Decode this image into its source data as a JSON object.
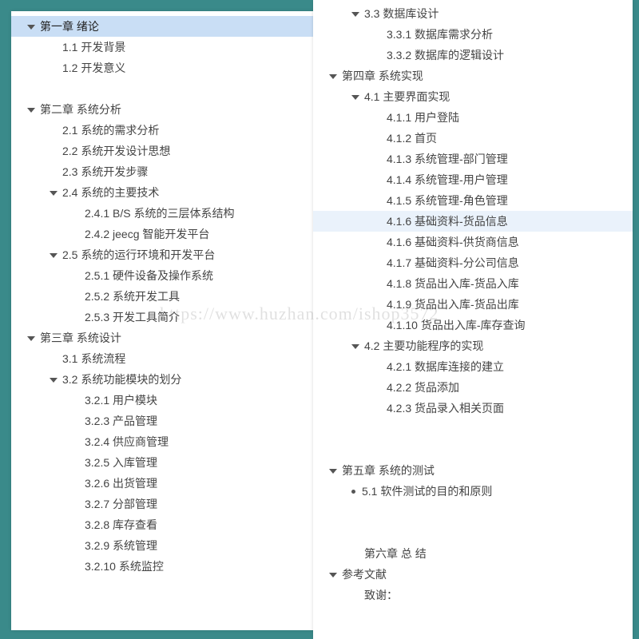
{
  "watermark": "https://www.huzhan.com/ishop3572",
  "left": [
    {
      "indent": 0,
      "marker": "arrow",
      "selected": "blue",
      "text": "第一章  绪论"
    },
    {
      "indent": 1,
      "marker": "none",
      "text": "1.1 开发背景"
    },
    {
      "indent": 1,
      "marker": "none",
      "text": "1.2 开发意义"
    },
    {
      "indent": 0,
      "marker": "none",
      "text": ""
    },
    {
      "indent": 0,
      "marker": "arrow",
      "text": "第二章  系统分析"
    },
    {
      "indent": 1,
      "marker": "none",
      "text": "2.1 系统的需求分析"
    },
    {
      "indent": 1,
      "marker": "none",
      "text": "2.2 系统开发设计思想"
    },
    {
      "indent": 1,
      "marker": "none",
      "text": "2.3 系统开发步骤"
    },
    {
      "indent": 1,
      "marker": "arrow",
      "text": "2.4 系统的主要技术"
    },
    {
      "indent": 2,
      "marker": "none",
      "text": "2.4.1 B/S 系统的三层体系结构"
    },
    {
      "indent": 2,
      "marker": "none",
      "text": "2.4.2 jeecg  智能开发平台"
    },
    {
      "indent": 1,
      "marker": "arrow",
      "text": "2.5 系统的运行环境和开发平台"
    },
    {
      "indent": 2,
      "marker": "none",
      "text": "2.5.1 硬件设备及操作系统"
    },
    {
      "indent": 2,
      "marker": "none",
      "text": "2.5.2 系统开发工具"
    },
    {
      "indent": 2,
      "marker": "none",
      "text": "2.5.3 开发工具简介"
    },
    {
      "indent": 0,
      "marker": "arrow",
      "text": "第三章  系统设计"
    },
    {
      "indent": 1,
      "marker": "none",
      "text": "3.1 系统流程"
    },
    {
      "indent": 1,
      "marker": "arrow",
      "text": "3.2 系统功能模块的划分"
    },
    {
      "indent": 2,
      "marker": "none",
      "text": "3.2.1 用户模块"
    },
    {
      "indent": 2,
      "marker": "none",
      "text": "3.2.3 产品管理"
    },
    {
      "indent": 2,
      "marker": "none",
      "text": "3.2.4 供应商管理"
    },
    {
      "indent": 2,
      "marker": "none",
      "text": "3.2.5 入库管理"
    },
    {
      "indent": 2,
      "marker": "none",
      "text": "3.2.6 出货管理"
    },
    {
      "indent": 2,
      "marker": "none",
      "text": "3.2.7 分部管理"
    },
    {
      "indent": 2,
      "marker": "none",
      "text": "3.2.8 库存查看"
    },
    {
      "indent": 2,
      "marker": "none",
      "text": "3.2.9 系统管理"
    },
    {
      "indent": 2,
      "marker": "none",
      "text": "3.2.10 系统监控"
    }
  ],
  "right": [
    {
      "indent": 1,
      "marker": "arrow",
      "text": "3.3 数据库设计"
    },
    {
      "indent": 2,
      "marker": "none",
      "text": "3.3.1 数据库需求分析"
    },
    {
      "indent": 2,
      "marker": "none",
      "text": "3.3.2 数据库的逻辑设计"
    },
    {
      "indent": 0,
      "marker": "arrow",
      "text": "第四章  系统实现"
    },
    {
      "indent": 1,
      "marker": "arrow",
      "text": "4.1 主要界面实现"
    },
    {
      "indent": 2,
      "marker": "none",
      "text": "4.1.1 用户登陆"
    },
    {
      "indent": 2,
      "marker": "none",
      "text": "4.1.2 首页"
    },
    {
      "indent": 2,
      "marker": "none",
      "text": "4.1.3 系统管理-部门管理"
    },
    {
      "indent": 2,
      "marker": "none",
      "text": "4.1.4 系统管理-用户管理"
    },
    {
      "indent": 2,
      "marker": "none",
      "text": "4.1.5 系统管理-角色管理"
    },
    {
      "indent": 2,
      "marker": "none",
      "selected": "light",
      "text": "4.1.6 基础资料-货品信息"
    },
    {
      "indent": 2,
      "marker": "none",
      "text": "4.1.6 基础资料-供货商信息"
    },
    {
      "indent": 2,
      "marker": "none",
      "text": "4.1.7 基础资料-分公司信息"
    },
    {
      "indent": 2,
      "marker": "none",
      "text": "4.1.8 货品出入库-货品入库"
    },
    {
      "indent": 2,
      "marker": "none",
      "text": "4.1.9 货品出入库-货品出库"
    },
    {
      "indent": 2,
      "marker": "none",
      "text": "4.1.10 货品出入库-库存查询"
    },
    {
      "indent": 1,
      "marker": "arrow",
      "text": "4.2 主要功能程序的实现"
    },
    {
      "indent": 2,
      "marker": "none",
      "text": "4.2.1 数据库连接的建立"
    },
    {
      "indent": 2,
      "marker": "none",
      "text": "4.2.2 货品添加"
    },
    {
      "indent": 2,
      "marker": "none",
      "text": "4.2.3 货品录入相关页面"
    },
    {
      "indent": 0,
      "marker": "none",
      "text": ""
    },
    {
      "indent": 0,
      "marker": "none",
      "text": ""
    },
    {
      "indent": 0,
      "marker": "arrow",
      "text": "第五章  系统的测试"
    },
    {
      "indent": 1,
      "marker": "dot",
      "text": "5.1  软件测试的目的和原则"
    },
    {
      "indent": 0,
      "marker": "none",
      "text": ""
    },
    {
      "indent": 0,
      "marker": "none",
      "text": ""
    },
    {
      "indent": 1,
      "marker": "none",
      "text": "第六章    总 结"
    },
    {
      "indent": 0,
      "marker": "arrow",
      "text": "参考文献"
    },
    {
      "indent": 1,
      "marker": "none",
      "text": "致谢："
    }
  ]
}
